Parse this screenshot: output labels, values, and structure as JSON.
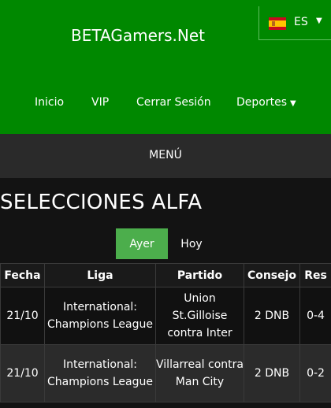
{
  "header": {
    "site_title": "BETAGamers.Net",
    "language": {
      "code": "ES",
      "flag": "spain-flag-icon"
    },
    "nav": [
      {
        "label": "Inicio"
      },
      {
        "label": "VIP"
      },
      {
        "label": "Cerrar Sesión"
      },
      {
        "label": "Deportes",
        "has_dropdown": true
      }
    ]
  },
  "menu_bar": {
    "label": "MENÚ"
  },
  "section": {
    "title": "SELECCIONES ALFA"
  },
  "day_tabs": [
    {
      "label": "Ayer",
      "active": true
    },
    {
      "label": "Hoy",
      "active": false
    }
  ],
  "table": {
    "headers": [
      "Fecha",
      "Liga",
      "Partido",
      "Consejo",
      "Res"
    ],
    "rows": [
      {
        "fecha": "21/10",
        "liga": "International: Champions League",
        "partido": "Union St.Gilloise contra Inter",
        "consejo": "2 DNB",
        "res": "0-4"
      },
      {
        "fecha": "21/10",
        "liga": "International: Champions League",
        "partido": "Villarreal contra Man City",
        "consejo": "2 DNB",
        "res": "0-2"
      }
    ]
  },
  "colors": {
    "header_bg": "#008800",
    "menu_bar_bg": "#2a2a2a",
    "page_bg": "#131313",
    "active_tab_bg": "#4cae4c"
  }
}
